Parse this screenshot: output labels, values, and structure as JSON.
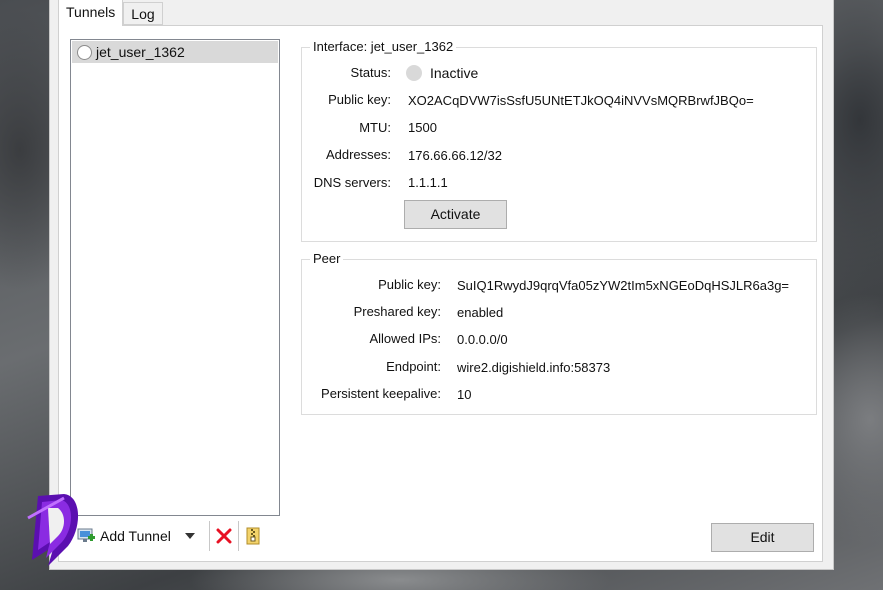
{
  "tabs": [
    {
      "label": "Tunnels"
    },
    {
      "label": "Log"
    }
  ],
  "tunnels": [
    {
      "name": "jet_user_1362"
    }
  ],
  "toolbar": {
    "add_tunnel_label": "Add Tunnel"
  },
  "interface": {
    "title": "Interface: jet_user_1362",
    "status_label": "Status:",
    "status_value": "Inactive",
    "public_key_label": "Public key:",
    "public_key_value": "XO2ACqDVW7isSsfU5UNtETJkOQ4iNVVsMQRBrwfJBQo=",
    "mtu_label": "MTU:",
    "mtu_value": "1500",
    "addresses_label": "Addresses:",
    "addresses_value": "176.66.66.12/32",
    "dns_label": "DNS servers:",
    "dns_value": "1.1.1.1",
    "activate_label": "Activate"
  },
  "peer": {
    "title": "Peer",
    "public_key_label": "Public key:",
    "public_key_value": "SuIQ1RwydJ9qrqVfa05zYW2tIm5xNGEoDqHSJLR6a3g=",
    "preshared_label": "Preshared key:",
    "preshared_value": "enabled",
    "allowed_ips_label": "Allowed IPs:",
    "allowed_ips_value": "0.0.0.0/0",
    "endpoint_label": "Endpoint:",
    "endpoint_value": "wire2.digishield.info:58373",
    "keepalive_label": "Persistent keepalive:",
    "keepalive_value": "10"
  },
  "edit_label": "Edit",
  "colors": {
    "selection": "#d9d9d9",
    "delete_red": "#e81123",
    "logo_purple": "#7a1fd1"
  }
}
